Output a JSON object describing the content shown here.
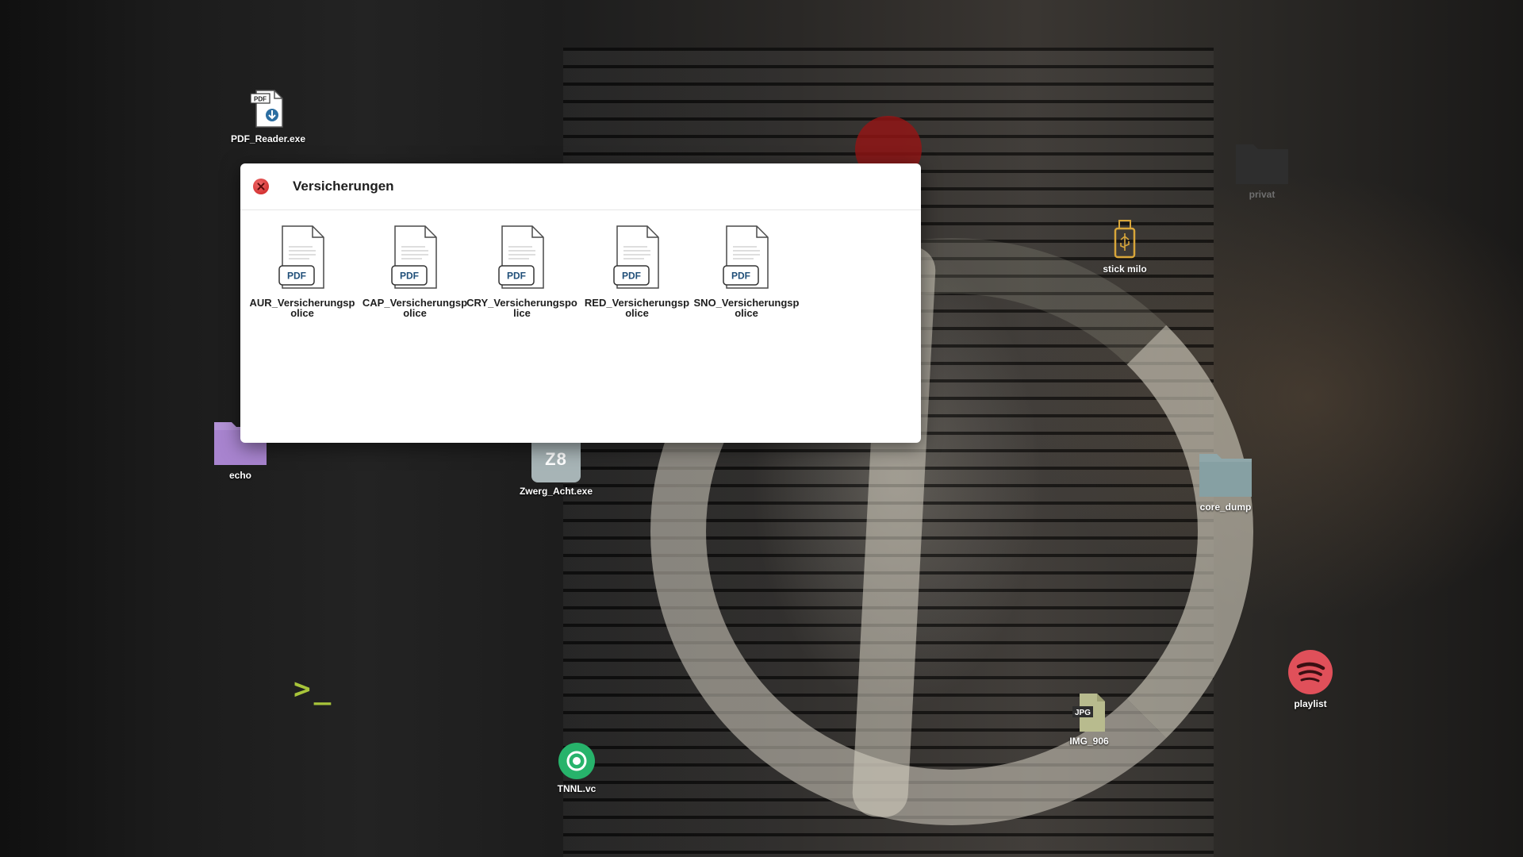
{
  "desktop": {
    "icons": {
      "pdf_reader": "PDF_Reader.exe",
      "privat": "privat",
      "stick": "stick milo",
      "echo": "echo",
      "zwerg": "Zwerg_Acht.exe",
      "zwerg_glyph": "Z8",
      "core_dump": "core_dump",
      "playlist": "playlist",
      "img": "IMG_906",
      "img_badge": "JPG",
      "tnnl": "TNNL.vc",
      "terminal": ">_"
    },
    "pdf_reader_badge": "PDF"
  },
  "window": {
    "title": "Versicherungen",
    "files": [
      {
        "name": "AUR_Versicherungspolice",
        "badge": "PDF"
      },
      {
        "name": "CAP_Versicherungspolice",
        "badge": "PDF"
      },
      {
        "name": "CRY_Versicherungspolice",
        "badge": "PDF"
      },
      {
        "name": "RED_Versicherungspolice",
        "badge": "PDF"
      },
      {
        "name": "SNO_Versicherungspolice",
        "badge": "PDF"
      }
    ]
  },
  "colors": {
    "pdf_badge": "#1f4e78",
    "echo_folder": "#b392d6",
    "core_dump_folder": "#8fa7aa",
    "spotify_red": "#e0505a",
    "tnnl_green": "#27b36b",
    "terminal_green": "#a8c53a",
    "usb_gold": "#d8a63a",
    "zwerg_tile": "#a7b4b6",
    "close_red": "#d92b2b"
  }
}
